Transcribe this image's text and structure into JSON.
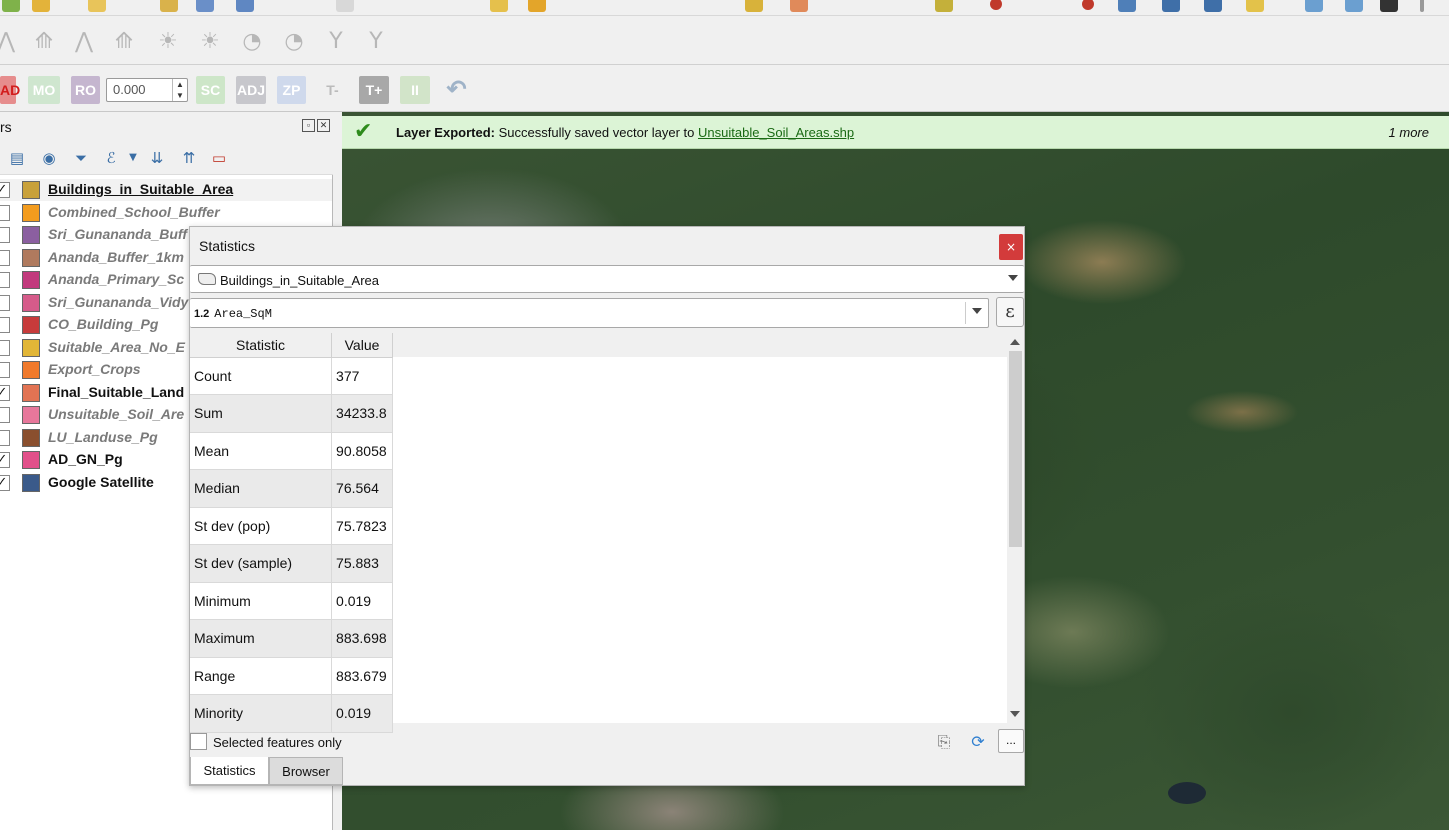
{
  "layers_panel": {
    "title": "rs",
    "items": [
      {
        "name": "Buildings_in_Suitable_Area",
        "checked": true,
        "color": "#c9a13a",
        "style": "vis cur",
        "selected": true
      },
      {
        "name": "Combined_School_Buffer",
        "checked": false,
        "color": "#f39c1e",
        "style": "hid"
      },
      {
        "name": "Sri_Gunananda_Buff",
        "checked": false,
        "color": "#8b5fa0",
        "style": "hid"
      },
      {
        "name": "Ananda_Buffer_1km",
        "checked": false,
        "color": "#b07a5e",
        "style": "hid"
      },
      {
        "name": "Ananda_Primary_Sc",
        "checked": false,
        "color": "#c23a7d",
        "style": "hid"
      },
      {
        "name": "Sri_Gunananda_Vidy",
        "checked": false,
        "color": "#d65b8a",
        "style": "hid"
      },
      {
        "name": "CO_Building_Pg",
        "checked": false,
        "color": "#c73b3b",
        "style": "hid"
      },
      {
        "name": "Suitable_Area_No_E",
        "checked": false,
        "color": "#e2b637",
        "style": "hid"
      },
      {
        "name": "Export_Crops",
        "checked": false,
        "color": "#f07a2c",
        "style": "hid"
      },
      {
        "name": "Final_Suitable_Land",
        "checked": true,
        "color": "#e27353",
        "style": "vis"
      },
      {
        "name": "Unsuitable_Soil_Are",
        "checked": false,
        "color": "#e7779b",
        "style": "hid"
      },
      {
        "name": "LU_Landuse_Pg",
        "checked": false,
        "color": "#8a4f2e",
        "style": "hid"
      },
      {
        "name": "AD_GN_Pg",
        "checked": true,
        "color": "#e2508a",
        "style": "vis"
      },
      {
        "name": "Google Satellite",
        "checked": true,
        "color": "#3a5a8a",
        "style": "vis"
      }
    ]
  },
  "advanced_toolbar": {
    "buttons": [
      "AD",
      "MO",
      "RO",
      "SC",
      "ADJ",
      "ZP",
      "T-",
      "T+",
      "II",
      "↶"
    ],
    "value": "0.000"
  },
  "notification": {
    "title": "Layer Exported:",
    "message": " Successfully saved vector layer to ",
    "link": "Unsuitable_Soil_Areas.shp",
    "more": "1 more"
  },
  "statistics": {
    "title": "Statistics",
    "close": "×",
    "layer": "Buildings_in_Suitable_Area",
    "field_type": "1.2",
    "field": "Area_SqM",
    "expression_btn": "ε",
    "col_statistic": "Statistic",
    "col_value": "Value",
    "rows": [
      {
        "stat": "Count",
        "value": "377"
      },
      {
        "stat": "Sum",
        "value": "34233.8"
      },
      {
        "stat": "Mean",
        "value": "90.8058"
      },
      {
        "stat": "Median",
        "value": "76.564"
      },
      {
        "stat": "St dev (pop)",
        "value": "75.7823"
      },
      {
        "stat": "St dev (sample)",
        "value": "75.883"
      },
      {
        "stat": "Minimum",
        "value": "0.019"
      },
      {
        "stat": "Maximum",
        "value": "883.698"
      },
      {
        "stat": "Range",
        "value": "883.679"
      },
      {
        "stat": "Minority",
        "value": "0.019"
      }
    ],
    "selected_only": "Selected features only",
    "more_btn": "...",
    "tabs": [
      "Statistics",
      "Browser"
    ]
  }
}
